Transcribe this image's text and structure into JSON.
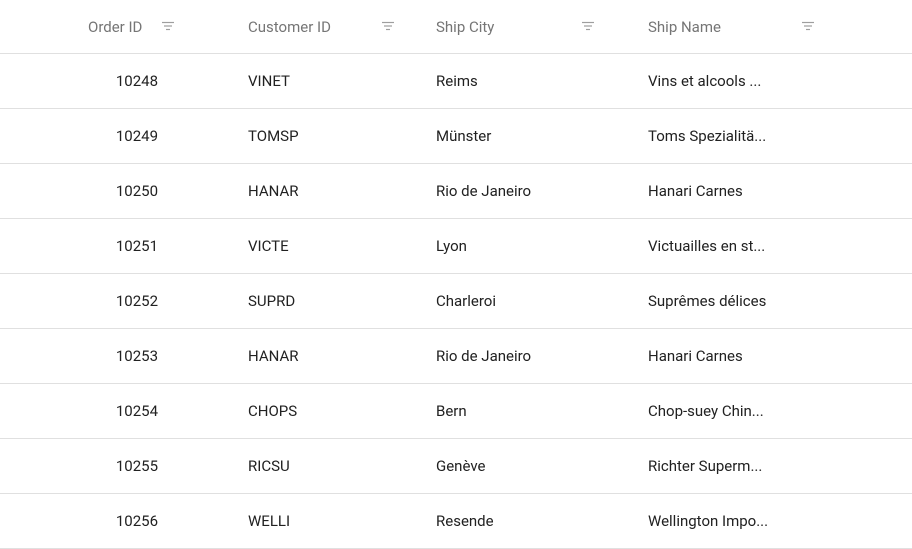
{
  "columns": {
    "order_id": "Order ID",
    "customer_id": "Customer ID",
    "ship_city": "Ship City",
    "ship_name": "Ship Name"
  },
  "rows": [
    {
      "order_id": "10248",
      "customer_id": "VINET",
      "ship_city": "Reims",
      "ship_name": "Vins et alcools ..."
    },
    {
      "order_id": "10249",
      "customer_id": "TOMSP",
      "ship_city": "Münster",
      "ship_name": "Toms Spezialitä..."
    },
    {
      "order_id": "10250",
      "customer_id": "HANAR",
      "ship_city": "Rio de Janeiro",
      "ship_name": "Hanari Carnes"
    },
    {
      "order_id": "10251",
      "customer_id": "VICTE",
      "ship_city": "Lyon",
      "ship_name": "Victuailles en st..."
    },
    {
      "order_id": "10252",
      "customer_id": "SUPRD",
      "ship_city": "Charleroi",
      "ship_name": "Suprêmes délices"
    },
    {
      "order_id": "10253",
      "customer_id": "HANAR",
      "ship_city": "Rio de Janeiro",
      "ship_name": "Hanari Carnes"
    },
    {
      "order_id": "10254",
      "customer_id": "CHOPS",
      "ship_city": "Bern",
      "ship_name": "Chop-suey Chin..."
    },
    {
      "order_id": "10255",
      "customer_id": "RICSU",
      "ship_city": "Genève",
      "ship_name": "Richter Superm..."
    },
    {
      "order_id": "10256",
      "customer_id": "WELLI",
      "ship_city": "Resende",
      "ship_name": "Wellington Impo..."
    }
  ]
}
